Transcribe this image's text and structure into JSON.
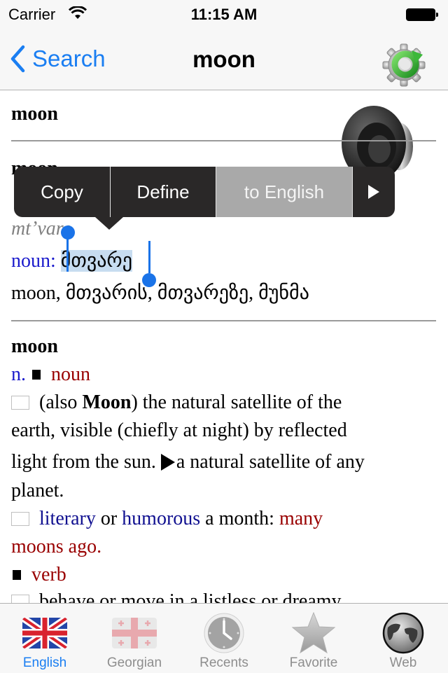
{
  "status_bar": {
    "carrier": "Carrier",
    "time": "11:15 AM"
  },
  "nav": {
    "back_label": "Search",
    "title": "moon",
    "right_icon": "gear-refresh-icon"
  },
  "entries": {
    "headword_1": "moon",
    "headword_2": "moon",
    "transliteration": "mt’vare",
    "pos_label": "noun:",
    "georgian_selected": "მთვარე",
    "forms": "moon, მთვარის, მთვარეზე, მუნმა",
    "headword_3": "moon",
    "abbr": "n.",
    "pos_noun": "noun",
    "def1_pre": "(also ",
    "def1_bold": "Moon",
    "def1_post": ") the natural satellite of the",
    "def1_line2": "earth, visible (chiefly at night) by reflected",
    "def1_line3a": "light from the sun. ",
    "def1_line3b": "a natural satellite of any",
    "def1_line4": "planet.",
    "def2_literary": "literary",
    "def2_or": " or ",
    "def2_humorous": "humorous",
    "def2_text": " a month: ",
    "def2_example_a": "many",
    "def2_example_b": "moons ago.",
    "pos_verb": "verb",
    "def3_text": "behave or move in a listless or dreamy"
  },
  "context_menu": {
    "items": [
      {
        "label": "Copy"
      },
      {
        "label": "Define"
      },
      {
        "label": "to English"
      }
    ],
    "more_icon": "triangle-right-icon"
  },
  "tab_bar": {
    "active": "English",
    "tabs": [
      {
        "label": "English",
        "icon": "uk-flag-icon"
      },
      {
        "label": "Georgian",
        "icon": "georgia-flag-icon"
      },
      {
        "label": "Recents",
        "icon": "clock-icon"
      },
      {
        "label": "Favorite",
        "icon": "star-icon"
      },
      {
        "label": "Web",
        "icon": "globe-icon"
      }
    ]
  },
  "colors": {
    "accent": "#1a7ef2",
    "pos_blue": "#1a1acc",
    "example_red": "#990000",
    "selection": "#c7dcf0"
  }
}
